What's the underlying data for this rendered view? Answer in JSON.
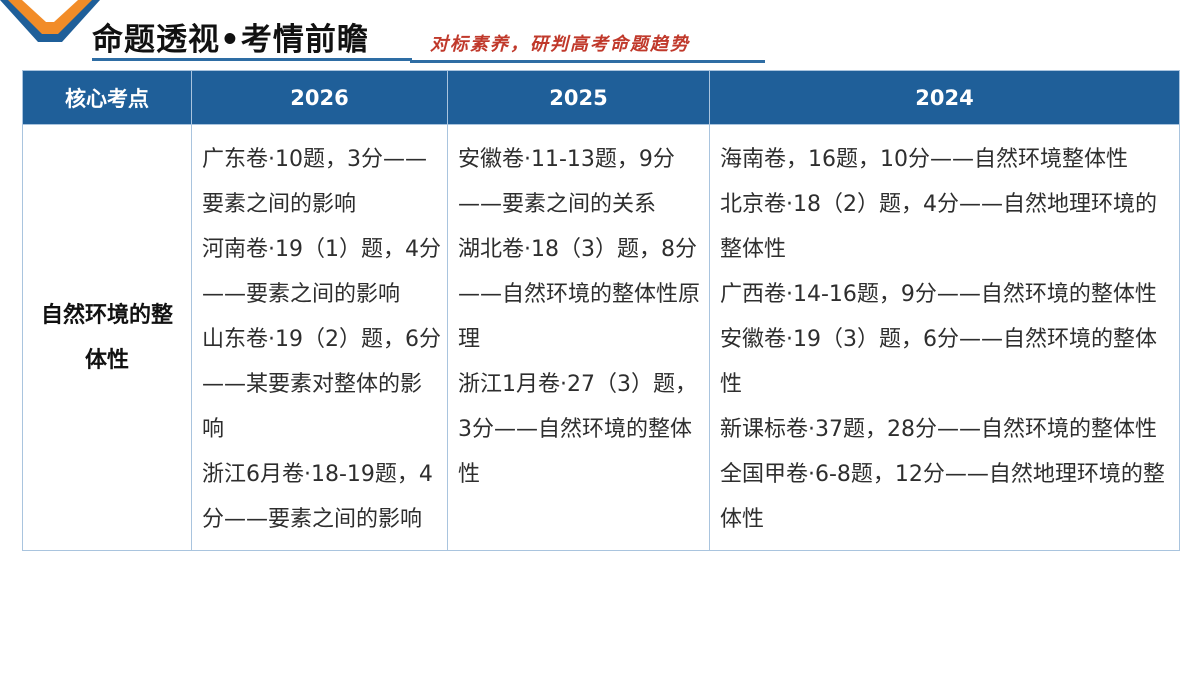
{
  "header": {
    "title": "命题透视•考情前瞻",
    "subtitle": "对标素养，研判高考命题趋势"
  },
  "colors": {
    "header_bg": "#1f5f99",
    "accent_blue": "#2e6da4",
    "subtitle_red": "#c0392b",
    "chevron_orange": "#f28c28"
  },
  "table": {
    "columns": [
      "核心考点",
      "2026",
      "2025",
      "2024"
    ],
    "topic": "自然环境的整体性",
    "col2026": [
      "广东卷·10题，3分——要素之间的影响",
      "河南卷·19（1）题，4分——要素之间的影响",
      "山东卷·19（2）题，6分——某要素对整体的影响",
      "浙江6月卷·18-19题，4分——要素之间的影响"
    ],
    "col2025": [
      "安徽卷·11-13题，9分——要素之间的关系",
      "湖北卷·18（3）题，8分——自然环境的整体性原理",
      "浙江1月卷·27（3）题，3分——自然环境的整体性"
    ],
    "col2024": [
      "海南卷，16题，10分——自然环境整体性",
      "北京卷·18（2）题，4分——自然地理环境的整体性",
      "广西卷·14-16题，9分——自然环境的整体性",
      "安徽卷·19（3）题，6分——自然环境的整体性",
      "新课标卷·37题，28分——自然环境的整体性",
      "全国甲卷·6-8题，12分——自然地理环境的整体性"
    ]
  }
}
